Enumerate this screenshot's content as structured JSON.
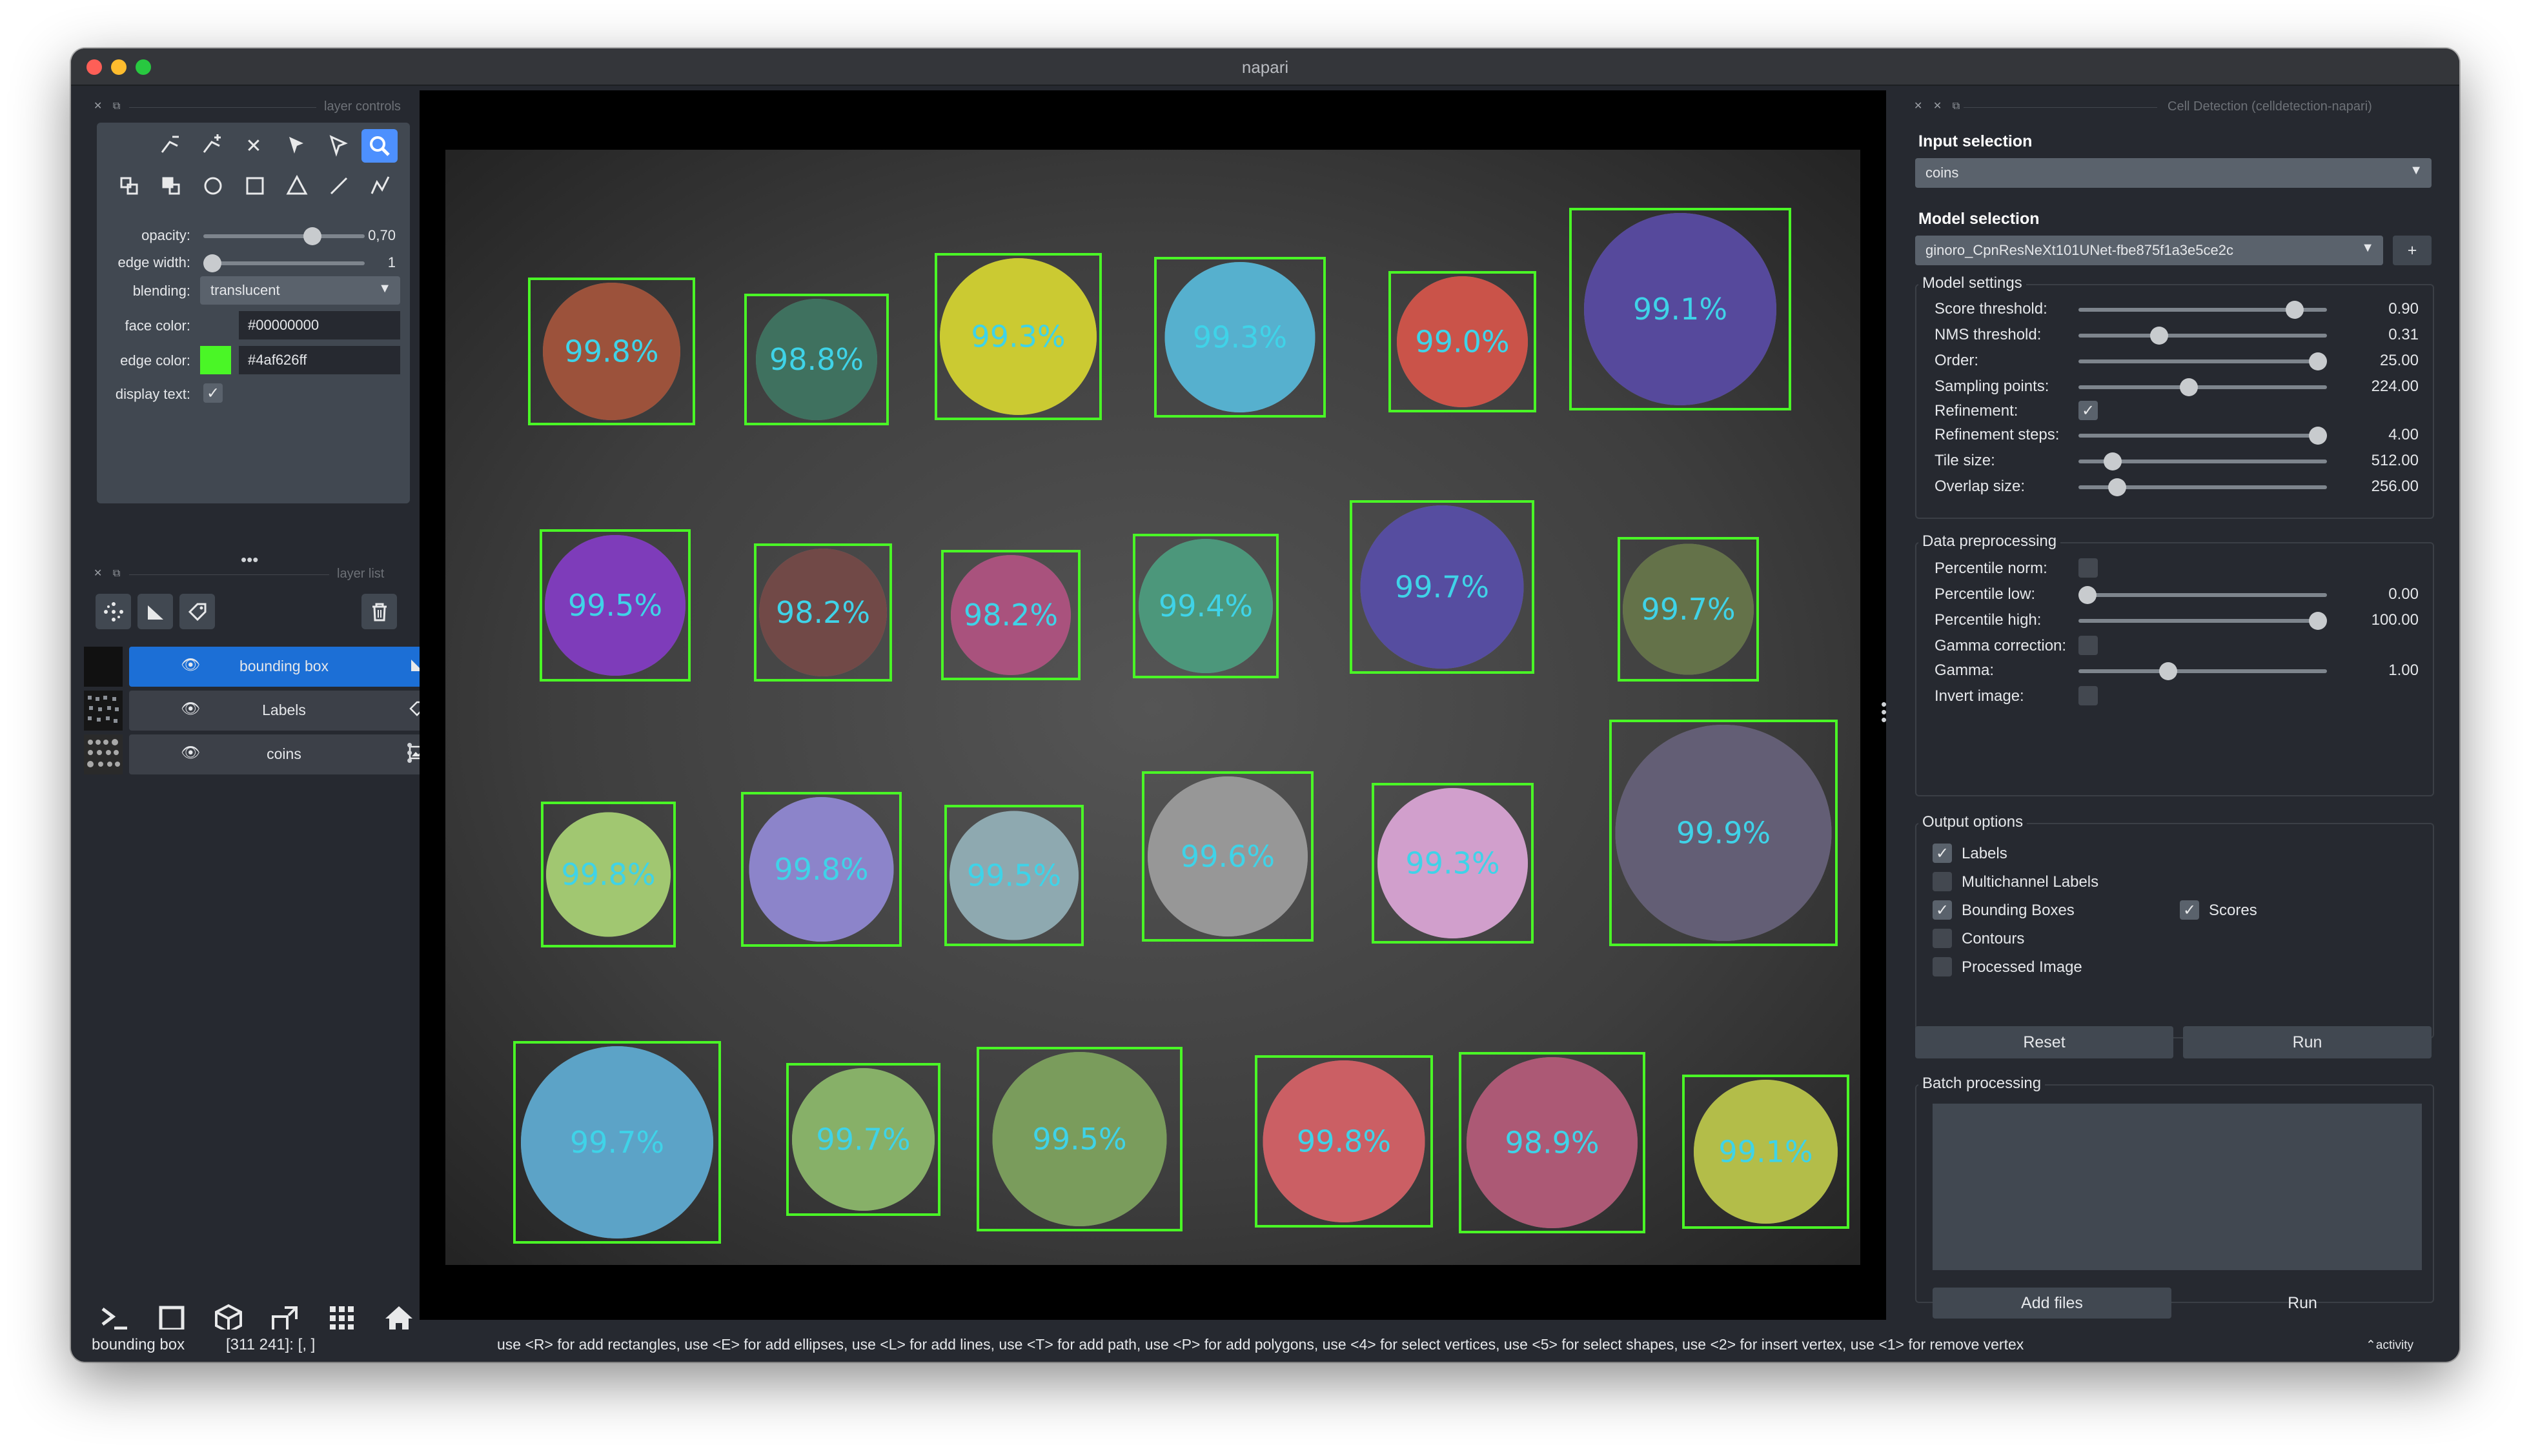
{
  "window": {
    "title": "napari"
  },
  "layer_controls": {
    "header": "layer controls",
    "opacity": {
      "label": "opacity:",
      "value": "0,70",
      "level": 0.7
    },
    "edge_width": {
      "label": "edge width:",
      "value": "1",
      "level": 0.0
    },
    "blending": {
      "label": "blending:",
      "value": "translucent"
    },
    "face_color": {
      "label": "face color:",
      "value": "#00000000"
    },
    "edge_color": {
      "label": "edge color:",
      "value": "#4af626ff",
      "swatch": "#4af626"
    },
    "display_text": {
      "label": "display text:",
      "checked": true
    }
  },
  "layer_list": {
    "header": "layer list",
    "layers": [
      {
        "name": "bounding box",
        "selected": true
      },
      {
        "name": "Labels",
        "selected": false
      },
      {
        "name": "coins",
        "selected": false
      }
    ]
  },
  "detections": [
    {
      "label": "99.8%",
      "color": "#a0452a"
    },
    {
      "label": "98.8%",
      "color": "#2e6b55"
    },
    {
      "label": "99.3%",
      "color": "#d9d81f"
    },
    {
      "label": "99.3%",
      "color": "#4ab8dd"
    },
    {
      "label": "99.0%",
      "color": "#d8473b"
    },
    {
      "label": "99.1%",
      "color": "#4b3aa0"
    },
    {
      "label": "99.5%",
      "color": "#7b2bc4"
    },
    {
      "label": "98.2%",
      "color": "#6b3a38"
    },
    {
      "label": "98.2%",
      "color": "#b0457a"
    },
    {
      "label": "99.4%",
      "color": "#3e9a78"
    },
    {
      "label": "99.7%",
      "color": "#4a3fa5"
    },
    {
      "label": "99.7%",
      "color": "#5c6d3a"
    },
    {
      "label": "99.8%",
      "color": "#a6d46b"
    },
    {
      "label": "99.8%",
      "color": "#8c82d8"
    },
    {
      "label": "99.5%",
      "color": "#8fb0b8"
    },
    {
      "label": "99.6%",
      "color": "#9a9a9a"
    },
    {
      "label": "99.3%",
      "color": "#e0a3db"
    },
    {
      "label": "99.9%",
      "color": "#5a5470"
    },
    {
      "label": "99.7%",
      "color": "#52a8d4"
    },
    {
      "label": "99.7%",
      "color": "#86b860"
    },
    {
      "label": "99.5%",
      "color": "#76a052"
    },
    {
      "label": "99.8%",
      "color": "#d9555c"
    },
    {
      "label": "98.9%",
      "color": "#b34e70"
    },
    {
      "label": "99.1%",
      "color": "#bcc83a"
    }
  ],
  "cell_detection": {
    "header": "Cell Detection (celldetection-napari)",
    "input_selection": {
      "title": "Input selection",
      "value": "coins"
    },
    "model_selection": {
      "title": "Model selection",
      "value": "ginoro_CpnResNeXt101UNet-fbe875f1a3e5ce2c",
      "add_label": "+"
    },
    "model_settings": {
      "title": "Model settings",
      "score_threshold": {
        "label": "Score threshold:",
        "value": "0.90",
        "level": 0.9
      },
      "nms_threshold": {
        "label": "NMS threshold:",
        "value": "0.31",
        "level": 0.31
      },
      "order": {
        "label": "Order:",
        "value": "25.00",
        "level": 1.0
      },
      "sampling_points": {
        "label": "Sampling points:",
        "value": "224.00",
        "level": 0.44
      },
      "refinement": {
        "label": "Refinement:",
        "checked": true
      },
      "refinement_steps": {
        "label": "Refinement steps:",
        "value": "4.00",
        "level": 1.0
      },
      "tile_size": {
        "label": "Tile size:",
        "value": "512.00",
        "level": 0.11
      },
      "overlap_size": {
        "label": "Overlap size:",
        "value": "256.00",
        "level": 0.13
      }
    },
    "data_preprocessing": {
      "title": "Data preprocessing",
      "percentile_norm": {
        "label": "Percentile norm:",
        "checked": false
      },
      "percentile_low": {
        "label": "Percentile low:",
        "value": "0.00",
        "level": 0.0
      },
      "percentile_high": {
        "label": "Percentile high:",
        "value": "100.00",
        "level": 1.0
      },
      "gamma_correction": {
        "label": "Gamma correction:",
        "checked": false
      },
      "gamma": {
        "label": "Gamma:",
        "value": "1.00",
        "level": 0.35
      },
      "invert_image": {
        "label": "Invert image:",
        "checked": false
      }
    },
    "output_options": {
      "title": "Output options",
      "labels": {
        "label": "Labels",
        "checked": true
      },
      "multichannel_labels": {
        "label": "Multichannel Labels",
        "checked": false
      },
      "bounding_boxes": {
        "label": "Bounding Boxes",
        "checked": true
      },
      "scores": {
        "label": "Scores",
        "checked": true
      },
      "contours": {
        "label": "Contours",
        "checked": false
      },
      "processed_image": {
        "label": "Processed Image",
        "checked": false
      }
    },
    "reset_label": "Reset",
    "run_label": "Run",
    "batch_processing": {
      "title": "Batch processing",
      "add_files_label": "Add files",
      "run_label": "Run"
    }
  },
  "status_bar": {
    "layer": "bounding box",
    "coords": "[311 241]: [, ]",
    "help": "use <R> for add rectangles, use <E> for add ellipses, use <L> for add lines, use <T> for add path, use <P> for add polygons, use <4> for select vertices, use <5> for select shapes, use <2> for insert vertex, use <1> for remove vertex",
    "activity": "activity"
  }
}
